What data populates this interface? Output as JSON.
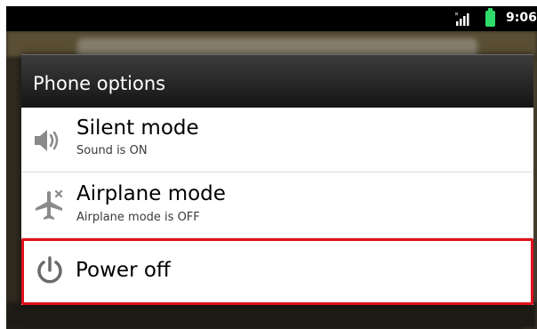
{
  "status_bar": {
    "time": "9:06",
    "icons": [
      "signal-icon",
      "battery-icon"
    ],
    "battery_color": "#2fdc6b"
  },
  "dialog": {
    "title": "Phone options",
    "options": [
      {
        "icon": "speaker-icon",
        "title": "Silent mode",
        "subtitle": "Sound is ON"
      },
      {
        "icon": "airplane-icon",
        "title": "Airplane mode",
        "subtitle": "Airplane mode is OFF"
      },
      {
        "icon": "power-icon",
        "title": "Power off",
        "highlighted": true
      }
    ]
  },
  "colors": {
    "header_bg": "#202020",
    "highlight_border": "#e0101c"
  }
}
